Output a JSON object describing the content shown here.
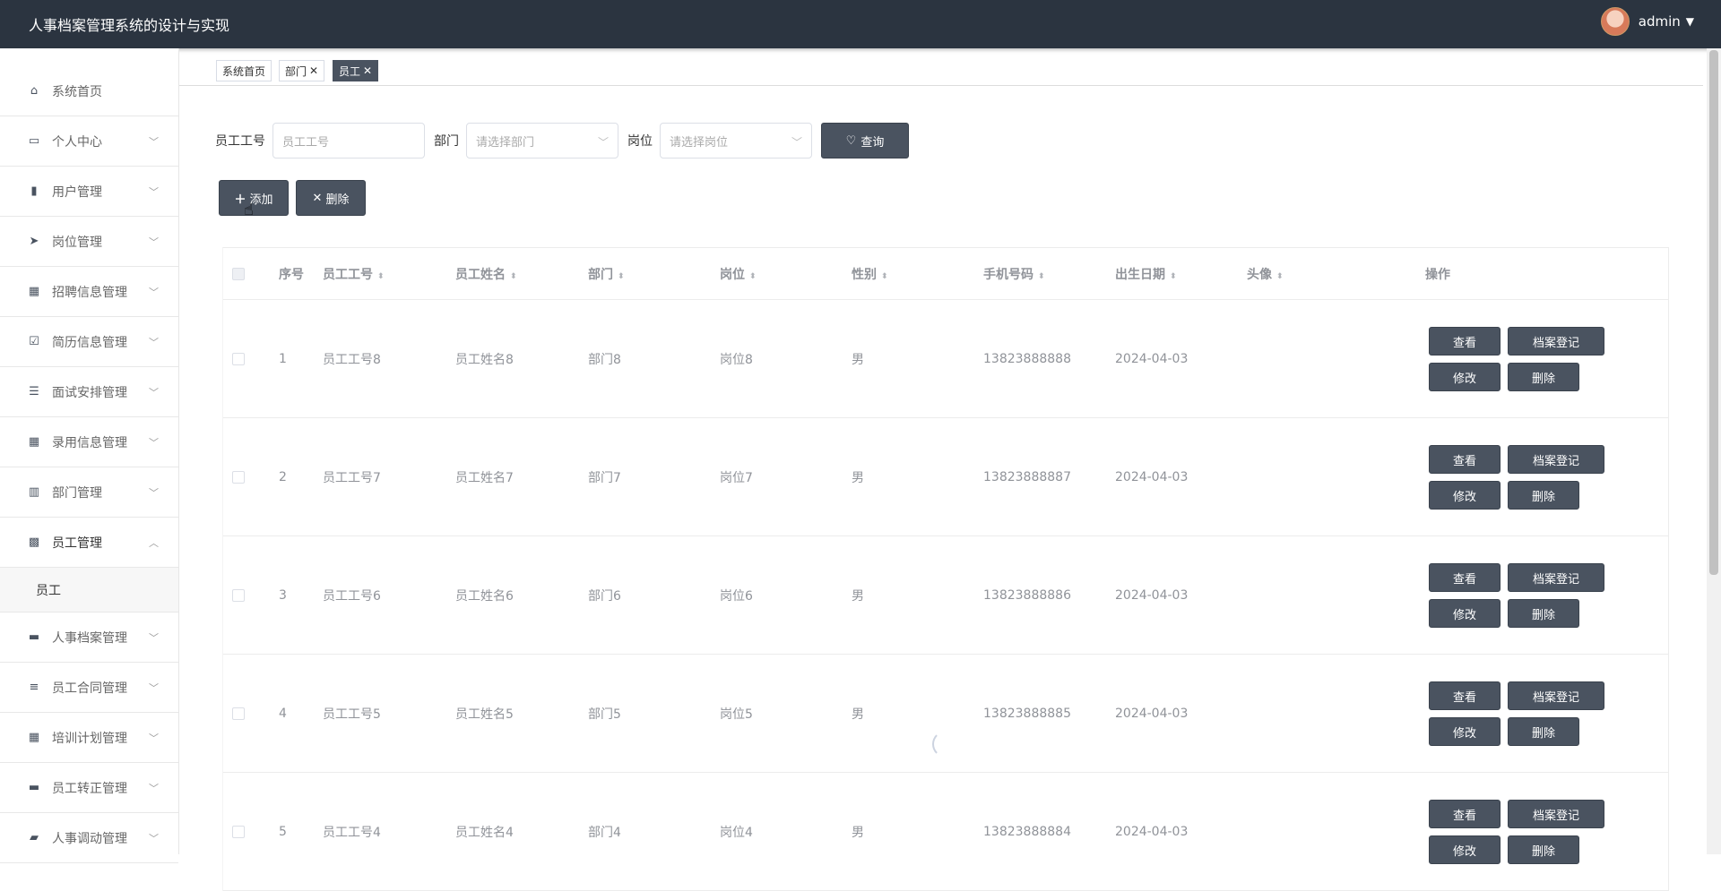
{
  "header": {
    "title": "人事档案管理系统的设计与实现",
    "username": "admin"
  },
  "sidebar": {
    "items": [
      {
        "label": "系统首页",
        "icon": "home-icon"
      },
      {
        "label": "个人中心",
        "icon": "card-icon"
      },
      {
        "label": "用户管理",
        "icon": "clipboard-icon"
      },
      {
        "label": "岗位管理",
        "icon": "send-icon"
      },
      {
        "label": "招聘信息管理",
        "icon": "grid-icon"
      },
      {
        "label": "简历信息管理",
        "icon": "check-clipboard-icon"
      },
      {
        "label": "面试安排管理",
        "icon": "list-icon"
      },
      {
        "label": "录用信息管理",
        "icon": "grid-icon"
      },
      {
        "label": "部门管理",
        "icon": "bar-icon"
      },
      {
        "label": "员工管理",
        "icon": "apps-icon"
      },
      {
        "label": "人事档案管理",
        "icon": "briefcase-icon"
      },
      {
        "label": "员工合同管理",
        "icon": "sliders-icon"
      },
      {
        "label": "培训计划管理",
        "icon": "grid-icon"
      },
      {
        "label": "员工转正管理",
        "icon": "message-icon"
      },
      {
        "label": "人事调动管理",
        "icon": "ticket-icon"
      }
    ],
    "sub_item": "员工"
  },
  "tabs": [
    {
      "label": "系统首页"
    },
    {
      "label": "部门",
      "close": "✕"
    },
    {
      "label": "员工",
      "close": "✕"
    }
  ],
  "search": {
    "emp_no_label": "员工工号",
    "emp_no_placeholder": "员工工号",
    "dept_label": "部门",
    "dept_placeholder": "请选择部门",
    "post_label": "岗位",
    "post_placeholder": "请选择岗位",
    "query_label": "查询"
  },
  "actions": {
    "add_label": "添加",
    "delete_label": "删除"
  },
  "table": {
    "headers": [
      "序号",
      "员工工号",
      "员工姓名",
      "部门",
      "岗位",
      "性别",
      "手机号码",
      "出生日期",
      "头像",
      "操作"
    ],
    "rows": [
      {
        "idx": "1",
        "no": "员工工号8",
        "name": "员工姓名8",
        "dept": "部门8",
        "post": "岗位8",
        "sex": "男",
        "phone": "13823888888",
        "birth": "2024-04-03"
      },
      {
        "idx": "2",
        "no": "员工工号7",
        "name": "员工姓名7",
        "dept": "部门7",
        "post": "岗位7",
        "sex": "男",
        "phone": "13823888887",
        "birth": "2024-04-03"
      },
      {
        "idx": "3",
        "no": "员工工号6",
        "name": "员工姓名6",
        "dept": "部门6",
        "post": "岗位6",
        "sex": "男",
        "phone": "13823888886",
        "birth": "2024-04-03"
      },
      {
        "idx": "4",
        "no": "员工工号5",
        "name": "员工姓名5",
        "dept": "部门5",
        "post": "岗位5",
        "sex": "男",
        "phone": "13823888885",
        "birth": "2024-04-03"
      },
      {
        "idx": "5",
        "no": "员工工号4",
        "name": "员工姓名4",
        "dept": "部门4",
        "post": "岗位4",
        "sex": "男",
        "phone": "13823888884",
        "birth": "2024-04-03"
      }
    ],
    "row_buttons": {
      "view": "查看",
      "archive": "档案登记",
      "edit": "修改",
      "delete": "删除"
    }
  }
}
